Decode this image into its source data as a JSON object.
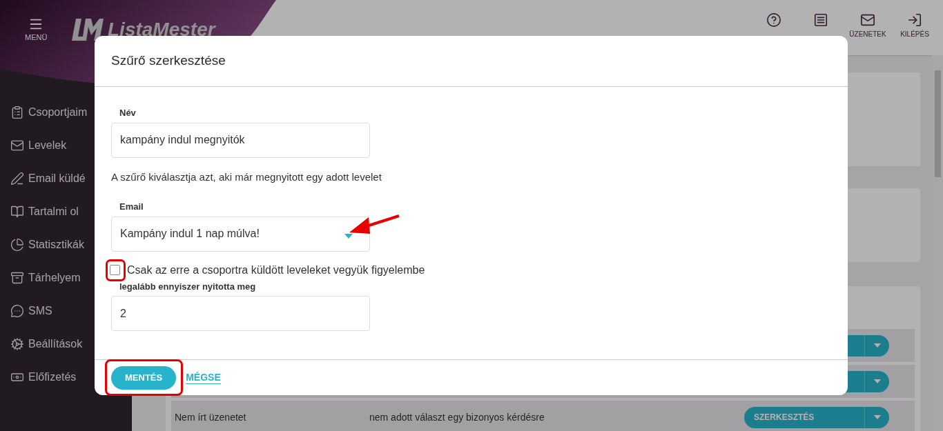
{
  "header": {
    "menu_label": "MENÜ",
    "logo_text": "ListaMester",
    "actions": [
      {
        "kind": "help"
      },
      {
        "kind": "manual"
      },
      {
        "kind": "messages",
        "label": "ÜZENETEK"
      },
      {
        "kind": "logout",
        "label": "KILÉPÉS"
      }
    ]
  },
  "sidebar": {
    "items": [
      {
        "kind": "clipboard",
        "label": "Csoportjaim"
      },
      {
        "kind": "mail",
        "label": "Levelek"
      },
      {
        "kind": "pencil",
        "label": "Email küldé"
      },
      {
        "kind": "book",
        "label": "Tartalmi ol"
      },
      {
        "kind": "chart",
        "label": "Statisztikák"
      },
      {
        "kind": "archive",
        "label": "Tárhelyem"
      },
      {
        "kind": "chat",
        "label": "SMS"
      },
      {
        "kind": "gear",
        "label": "Beállítások"
      },
      {
        "kind": "money",
        "label": "Előfizetés"
      }
    ]
  },
  "filter_table": {
    "rows": [
      {
        "kind": "covered"
      },
      {
        "kind": "covered"
      },
      {
        "kind": "full",
        "name": "Nem írt üzenetet",
        "description": "nem adott választ egy bizonyos kérdésre",
        "action": "SZERKESZTÉS"
      }
    ]
  },
  "dialog": {
    "title": "Szűrő szerkesztése",
    "name_field": {
      "label": "Név",
      "value": "kampány indul megnyitók"
    },
    "description": "A szűrő kiválasztja azt, aki már megnyitott egy adott levelet",
    "email_field": {
      "label": "Email",
      "value": "Kampány indul 1 nap múlva!"
    },
    "checkbox": {
      "label": "Csak az erre a csoportra küldött leveleket vegyük figyelembe",
      "checked": false
    },
    "count_field": {
      "label": "legalább ennyiszer nyitotta meg",
      "value": "2"
    },
    "buttons": [
      {
        "kind": "primary",
        "label": "MENTÉS"
      },
      {
        "kind": "link",
        "label": "MÉGSE"
      }
    ]
  }
}
